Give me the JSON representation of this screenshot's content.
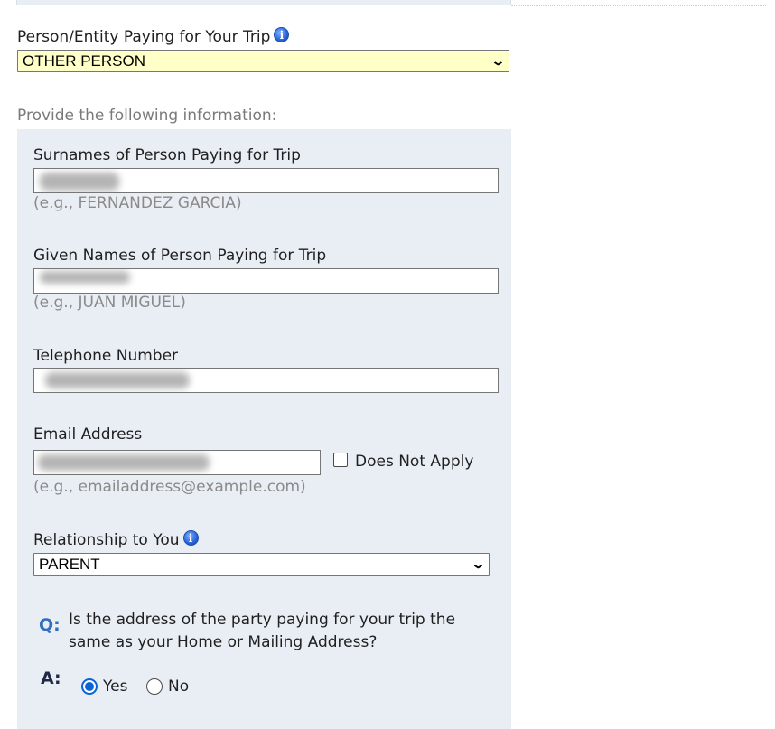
{
  "payer": {
    "label": "Person/Entity Paying for Your Trip",
    "info_icon": "info-icon",
    "selected": "OTHER PERSON"
  },
  "provide_text": "Provide the following information:",
  "fields": {
    "surnames": {
      "label": "Surnames of Person Paying for Trip",
      "value": "",
      "example": "(e.g., FERNANDEZ GARCIA)"
    },
    "given": {
      "label": "Given Names of Person Paying for Trip",
      "value": "",
      "example": "(e.g., JUAN MIGUEL)"
    },
    "telephone": {
      "label": "Telephone Number",
      "value": ""
    },
    "email": {
      "label": "Email Address",
      "value": "",
      "does_not_apply": "Does Not Apply",
      "example": "(e.g., emailaddress@example.com)"
    },
    "relationship": {
      "label": "Relationship to You",
      "selected": "PARENT"
    }
  },
  "question": {
    "q_marker": "Q:",
    "text": "Is the address of the party paying for your trip the same as your Home or Mailing Address?",
    "a_marker": "A:",
    "options": [
      "Yes",
      "No"
    ],
    "selected": "Yes"
  },
  "colors": {
    "panel_bg": "#e9eef5",
    "payer_select_bg": "#ffffc8",
    "q_color": "#2e6fbf",
    "radio_accent": "#0b63d6"
  }
}
